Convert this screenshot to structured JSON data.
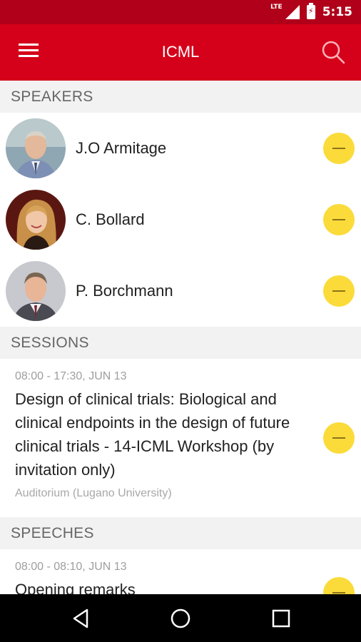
{
  "status_bar": {
    "network": "LTE",
    "time": "5:15"
  },
  "app_bar": {
    "title": "ICML"
  },
  "sections": {
    "speakers": {
      "header": "SPEAKERS",
      "items": [
        {
          "name": "J.O Armitage"
        },
        {
          "name": "C. Bollard"
        },
        {
          "name": "P. Borchmann"
        }
      ]
    },
    "sessions": {
      "header": "SESSIONS",
      "items": [
        {
          "time": "08:00 - 17:30, JUN 13",
          "title": "Design of clinical trials: Biological and clinical endpoints in the design of future clinical trials - 14-ICML Workshop (by invitation only)",
          "location": "Auditorium (Lugano University)"
        }
      ]
    },
    "speeches": {
      "header": "SPEECHES",
      "items": [
        {
          "time": "08:00 - 08:10, JUN 13",
          "title": "Opening remarks"
        }
      ]
    }
  },
  "icons": {
    "menu": "hamburger-icon",
    "search": "search-icon",
    "remove": "minus-circle-icon",
    "nav_back": "triangle-back-icon",
    "nav_home": "circle-home-icon",
    "nav_recents": "square-recents-icon"
  },
  "colors": {
    "status_bar": "#b0001a",
    "app_bar": "#d50019",
    "section_header_bg": "#f2f2f2",
    "remove_button": "#fbdb3a"
  }
}
